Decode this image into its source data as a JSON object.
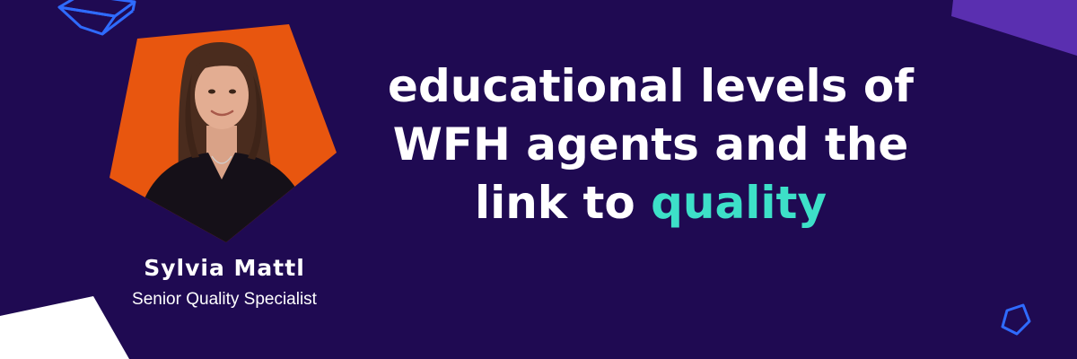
{
  "headline": {
    "line1": "educational levels of",
    "line2": "WFH agents and the",
    "line3_prefix": "link to ",
    "line3_accent": "quality"
  },
  "speaker": {
    "name": "Sylvia Mattl",
    "title": "Senior Quality Specialist",
    "photo_icon": "portrait-photo"
  },
  "colors": {
    "background": "#1f0a52",
    "accent_text": "#3de0c8",
    "portrait_frame": "#e8560f",
    "corner_shape": "#5a2fb0",
    "outline_shapes": "#2f6bff"
  }
}
